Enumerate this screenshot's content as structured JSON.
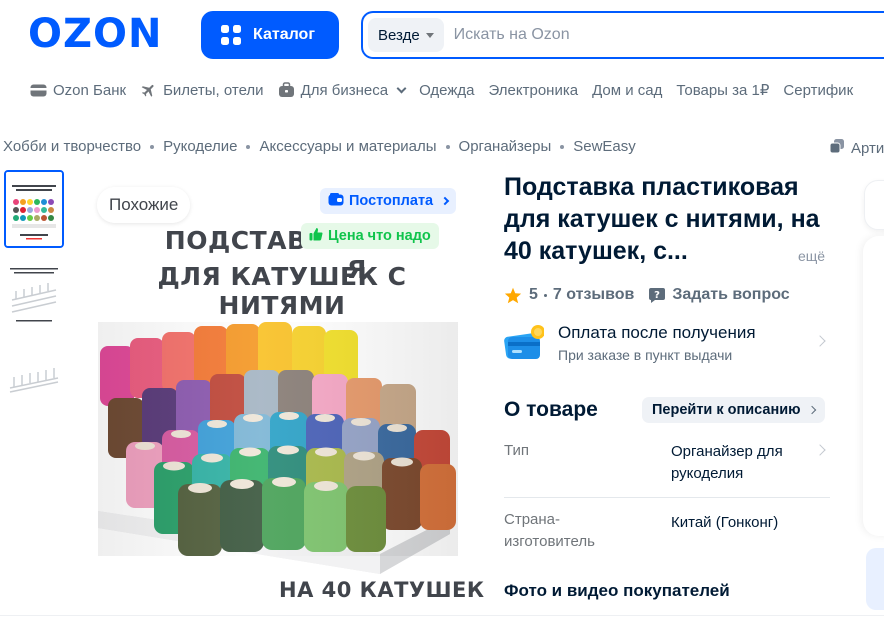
{
  "header": {
    "logo": "OZON",
    "catalog_label": "Каталог",
    "search_scope": "Везде",
    "search_placeholder": "Искать на Ozon"
  },
  "nav": {
    "items": [
      {
        "label": "Ozon Банк",
        "icon": "card-icon"
      },
      {
        "label": "Билеты, отели",
        "icon": "plane-icon"
      },
      {
        "label": "Для бизнеса",
        "icon": "briefcase-icon",
        "dropdown": true
      },
      {
        "label": "Одежда"
      },
      {
        "label": "Электроника"
      },
      {
        "label": "Дом и сад"
      },
      {
        "label": "Товары за 1₽"
      },
      {
        "label": "Сертифик"
      }
    ]
  },
  "breadcrumb": {
    "items": [
      "Хобби и творчество",
      "Рукоделие",
      "Аксессуары и материалы",
      "Органайзеры",
      "SewEasy"
    ],
    "article_label": "Арти"
  },
  "gallery": {
    "similar_label": "Похожие",
    "postpay_badge": "Постоплата",
    "price_badge": "Цена что надо",
    "heading_line1": "ПОДСТАВКА ПЛ",
    "heading_line1_tail": "Я",
    "heading_line2": "ДЛЯ КАТУШЕК С НИТЯМИ",
    "footer_text": "НА 40 КАТУШЕК"
  },
  "product": {
    "title": "Подставка пластиковая для катушек с нитями, на 40 катушек, с...",
    "more_label": "ещё",
    "rating": "5",
    "reviews": "7 отзывов",
    "ask_label": "Задать вопрос",
    "payment_title": "Оплата после получения",
    "payment_sub": "При заказе в пункт выдачи",
    "about_title": "О товаре",
    "goto_description": "Перейти к описанию",
    "specs": [
      {
        "label": "Тип",
        "value": "Органайзер для рукоделия"
      },
      {
        "label": "Страна-изготовитель",
        "value": "Китай (Гонконг)"
      }
    ],
    "photos_title": "Фото и видео покупателей"
  },
  "colors": {
    "brand": "#005bff",
    "price_green": "#10c44c",
    "star": "#ffa800"
  }
}
